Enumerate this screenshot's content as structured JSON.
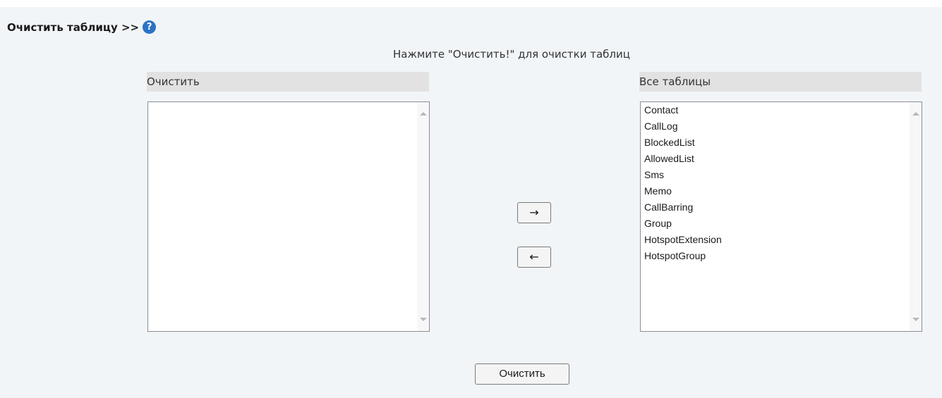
{
  "section": {
    "title": "Очистить таблицу >>",
    "help_icon": "question-circle-icon",
    "help_glyph": "?"
  },
  "instruction": "Нажмите \"Очистить!\" для очистки таблиц",
  "left_list": {
    "header": "Очистить",
    "items": []
  },
  "right_list": {
    "header": "Все таблицы",
    "items": [
      "Contact",
      "CallLog",
      "BlockedList",
      "AllowedList",
      "Sms",
      "Memo",
      "CallBarring",
      "Group",
      "HotspotExtension",
      "HotspotGroup"
    ]
  },
  "buttons": {
    "move_right": "→",
    "move_left": "←",
    "clear": "Очистить"
  },
  "colors": {
    "panel_bg": "#f1f5f8",
    "header_bg": "#e2e2e2",
    "help_icon": "#2b73c4"
  }
}
